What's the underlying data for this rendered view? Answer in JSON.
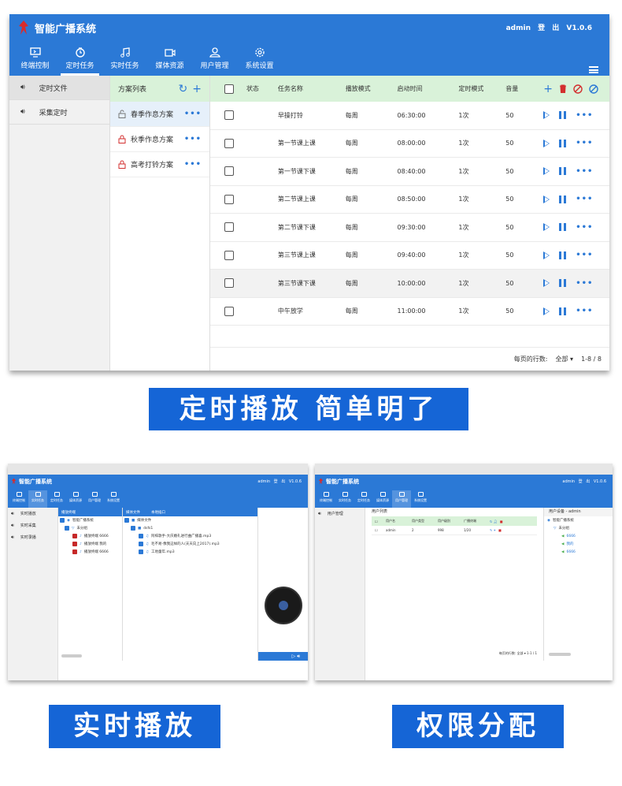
{
  "app": {
    "title": "智能广播系统",
    "user": "admin",
    "logout": "登 出",
    "version": "V1.0.6"
  },
  "nav": [
    {
      "label": "终端控制",
      "icon": "terminal-icon"
    },
    {
      "label": "定时任务",
      "icon": "timer-icon"
    },
    {
      "label": "实时任务",
      "icon": "music-note-icon"
    },
    {
      "label": "媒体资源",
      "icon": "video-camera-icon"
    },
    {
      "label": "用户管理",
      "icon": "user-icon"
    },
    {
      "label": "系统设置",
      "icon": "gear-icon"
    }
  ],
  "sidebar": [
    {
      "label": "定时文件",
      "icon": "speaker-icon"
    },
    {
      "label": "采集定时",
      "icon": "speaker-icon"
    }
  ],
  "plans": {
    "header": "方案列表",
    "items": [
      {
        "name": "春季作息方案",
        "locked": false
      },
      {
        "name": "秋季作息方案",
        "locked": true
      },
      {
        "name": "高考打铃方案",
        "locked": true
      }
    ]
  },
  "table": {
    "columns": [
      "状态",
      "任务名称",
      "播放模式",
      "启动时间",
      "定时模式",
      "音量"
    ],
    "rows": [
      {
        "name": "早操打铃",
        "mode": "每周",
        "time": "06:30:00",
        "timer": "1次",
        "volume": "50"
      },
      {
        "name": "第一节课上课",
        "mode": "每周",
        "time": "08:00:00",
        "timer": "1次",
        "volume": "50"
      },
      {
        "name": "第一节课下课",
        "mode": "每周",
        "time": "08:40:00",
        "timer": "1次",
        "volume": "50"
      },
      {
        "name": "第二节课上课",
        "mode": "每周",
        "time": "08:50:00",
        "timer": "1次",
        "volume": "50"
      },
      {
        "name": "第二节课下课",
        "mode": "每周",
        "time": "09:30:00",
        "timer": "1次",
        "volume": "50"
      },
      {
        "name": "第三节课上课",
        "mode": "每周",
        "time": "09:40:00",
        "timer": "1次",
        "volume": "50"
      },
      {
        "name": "第三节课下课",
        "mode": "每周",
        "time": "10:00:00",
        "timer": "1次",
        "volume": "50"
      },
      {
        "name": "中午放学",
        "mode": "每周",
        "time": "11:00:00",
        "timer": "1次",
        "volume": "50"
      }
    ],
    "footer": {
      "rows_per_page": "每页的行数:",
      "all": "全部",
      "range": "1-8 / 8"
    }
  },
  "captions": {
    "timed": "定时播放 简单明了",
    "realtime": "实时播放",
    "permission": "权限分配"
  },
  "shot2": {
    "title": "智能广播系统",
    "top": "admin  登 出  V1.0.6",
    "nav": [
      "终端控制",
      "实时任务",
      "定时任务",
      "媒体资源",
      "用户管理",
      "系统设置"
    ],
    "side": [
      "实时播放",
      "实时采集",
      "实时录播"
    ],
    "left_tabs": [
      "播放终端"
    ],
    "tree": [
      "智能广播系统",
      "未分组",
      "播放终端 6666",
      "播放终端 我的",
      "播放终端 6666"
    ],
    "right_tabs": [
      "媒体文件",
      "本地插口"
    ],
    "files": [
      "媒体文件",
      "dsfs1",
      "阿梓歌手-大庆婚礼进行曲广播喜.mp3",
      "毛不易-像我这样的人(天天向上2017).mp3",
      "工地童年.mp3"
    ]
  },
  "shot3": {
    "title": "智能广播系统",
    "top": "admin  登 出  V1.0.6",
    "nav": [
      "终端控制",
      "实时任务",
      "定时任务",
      "媒体资源",
      "用户管理",
      "系统设置"
    ],
    "side": [
      "用户管理"
    ],
    "list_title": "用户列表",
    "cols": [
      "用户名",
      "用户类型",
      "用户级别",
      "广播终端"
    ],
    "row": [
      "admin",
      "2",
      "998",
      "1/20"
    ],
    "right_title": "用户设备 - admin",
    "tree": [
      "智能广播系统",
      "未分组",
      "6666",
      "我的",
      "6666"
    ],
    "footer": "每页的行数:  全部  ▾  1-1 / 1"
  }
}
